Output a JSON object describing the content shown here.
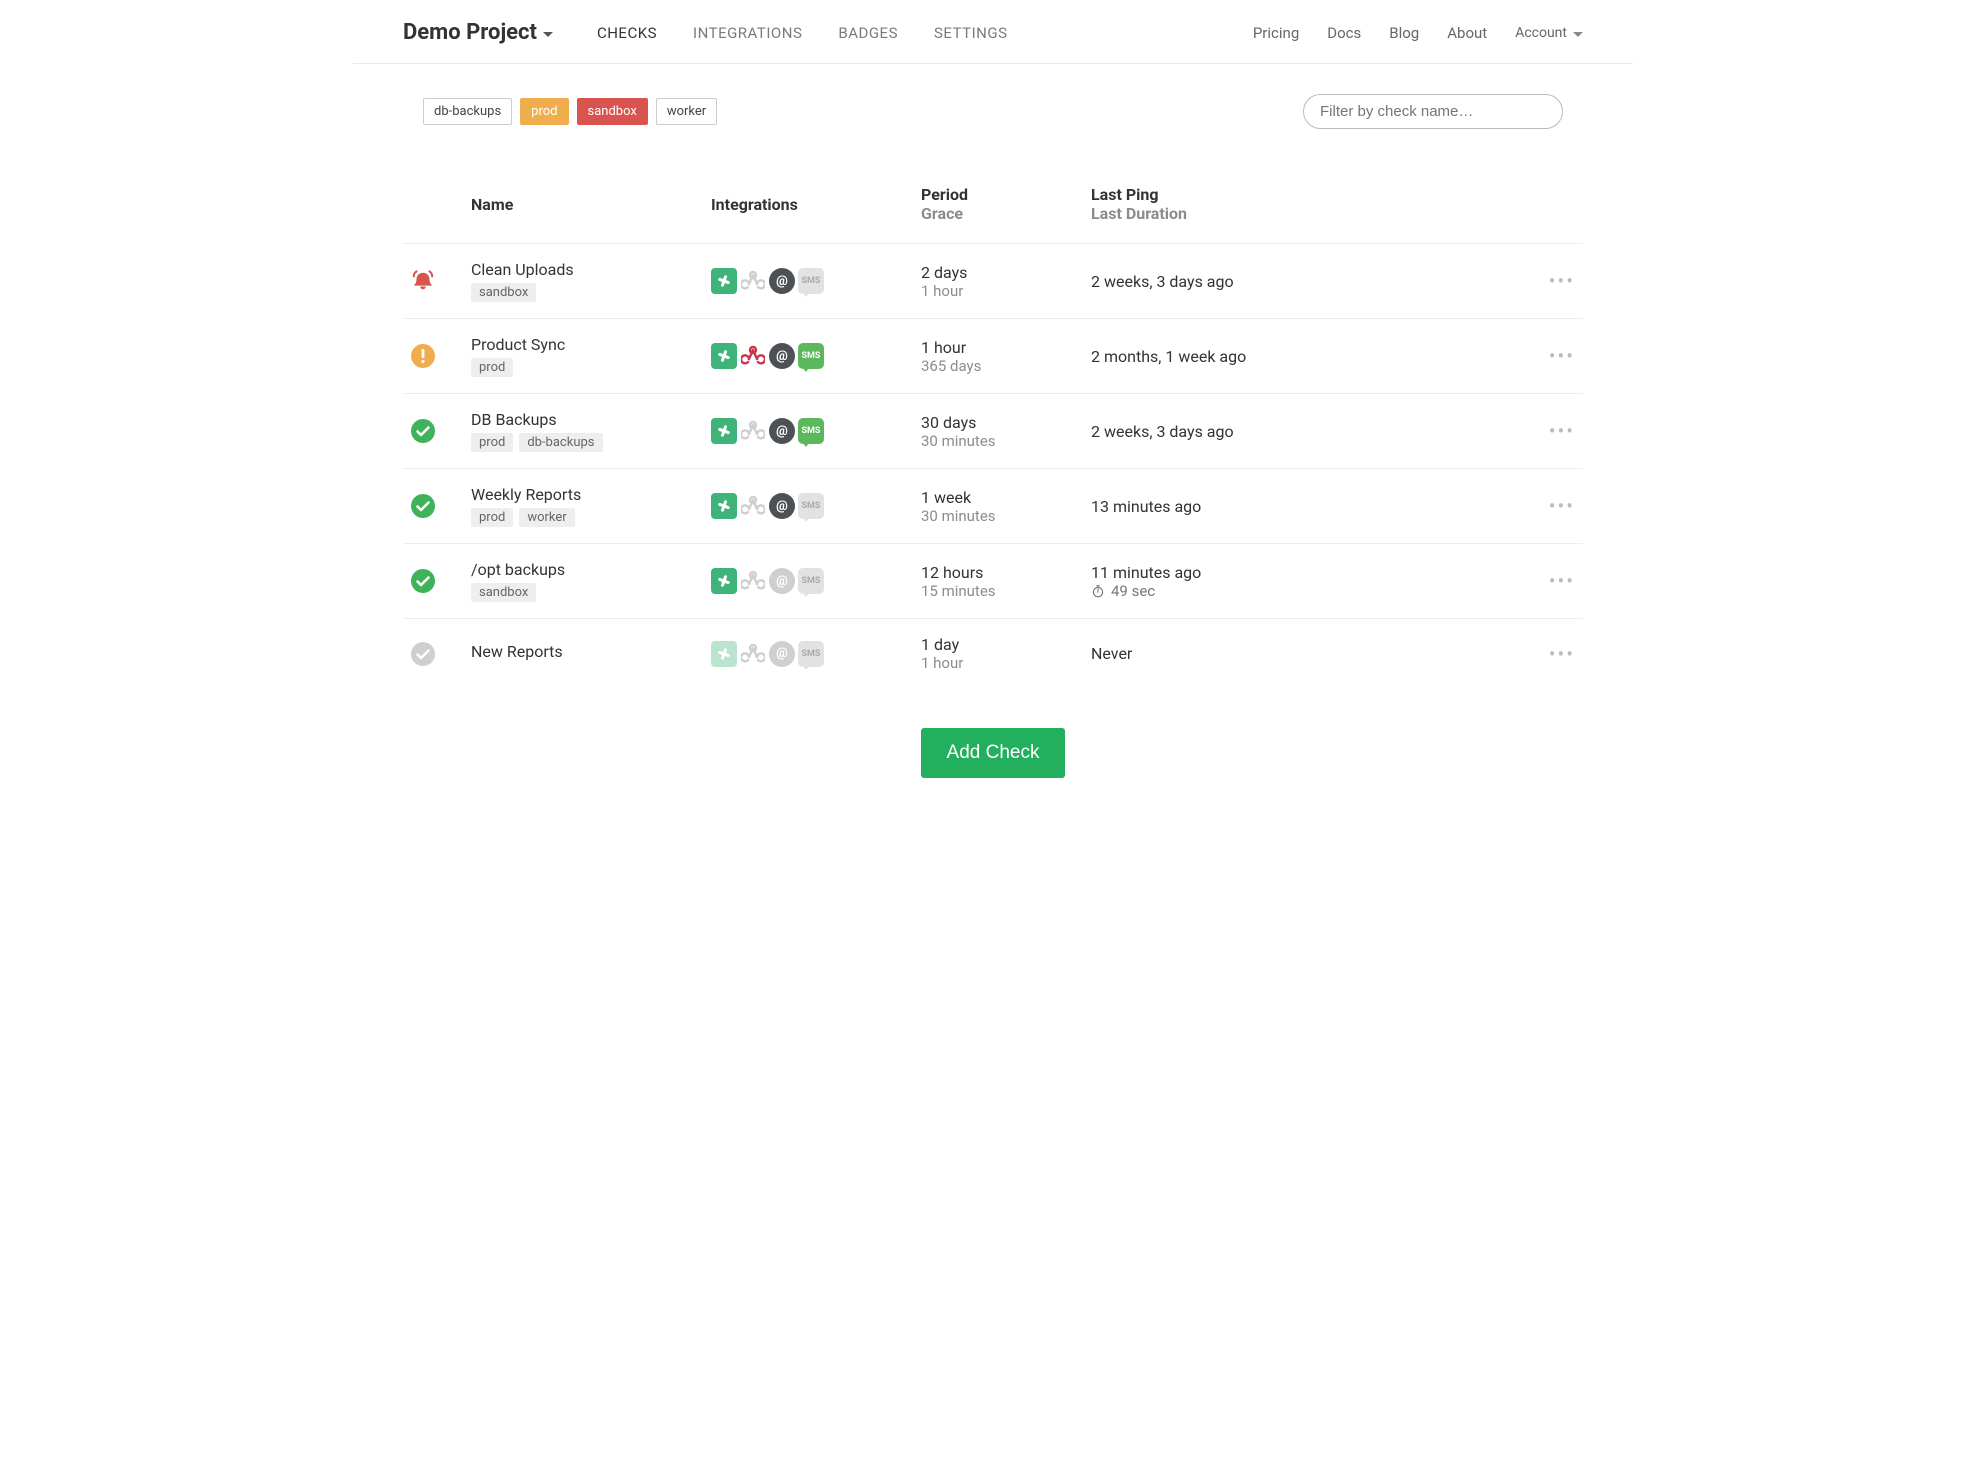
{
  "header": {
    "project_name": "Demo Project",
    "tabs": [
      {
        "label": "CHECKS",
        "active": true
      },
      {
        "label": "INTEGRATIONS",
        "active": false
      },
      {
        "label": "BADGES",
        "active": false
      },
      {
        "label": "SETTINGS",
        "active": false
      }
    ],
    "right_links": [
      "Pricing",
      "Docs",
      "Blog",
      "About"
    ],
    "account_label": "Account"
  },
  "filters": {
    "tags": [
      {
        "label": "db-backups",
        "style": "default"
      },
      {
        "label": "prod",
        "style": "orange"
      },
      {
        "label": "sandbox",
        "style": "red"
      },
      {
        "label": "worker",
        "style": "default"
      }
    ],
    "search_placeholder": "Filter by check name…"
  },
  "columns": {
    "name": "Name",
    "integrations": "Integrations",
    "period": "Period",
    "grace": "Grace",
    "last_ping": "Last Ping",
    "last_duration": "Last Duration"
  },
  "checks": [
    {
      "status": "down",
      "name": "Clean Uploads",
      "tags": [
        "sandbox"
      ],
      "integrations": {
        "slack": true,
        "webhook": false,
        "email": true,
        "sms": false
      },
      "period": "2 days",
      "grace": "1 hour",
      "last_ping": "2 weeks, 3 days ago",
      "duration": ""
    },
    {
      "status": "late",
      "name": "Product Sync",
      "tags": [
        "prod"
      ],
      "integrations": {
        "slack": true,
        "webhook": true,
        "email": true,
        "sms": true
      },
      "period": "1 hour",
      "grace": "365 days",
      "last_ping": "2 months, 1 week ago",
      "duration": ""
    },
    {
      "status": "up",
      "name": "DB Backups",
      "tags": [
        "prod",
        "db-backups"
      ],
      "integrations": {
        "slack": true,
        "webhook": false,
        "email": true,
        "sms": true
      },
      "period": "30 days",
      "grace": "30 minutes",
      "last_ping": "2 weeks, 3 days ago",
      "duration": ""
    },
    {
      "status": "up",
      "name": "Weekly Reports",
      "tags": [
        "prod",
        "worker"
      ],
      "integrations": {
        "slack": true,
        "webhook": false,
        "email": true,
        "sms": false
      },
      "period": "1 week",
      "grace": "30 minutes",
      "last_ping": "13 minutes ago",
      "duration": ""
    },
    {
      "status": "up",
      "name": "/opt backups",
      "tags": [
        "sandbox"
      ],
      "integrations": {
        "slack": true,
        "webhook": false,
        "email": false,
        "sms": false
      },
      "period": "12 hours",
      "grace": "15 minutes",
      "last_ping": "11 minutes ago",
      "duration": "49 sec"
    },
    {
      "status": "new",
      "name": "New Reports",
      "tags": [],
      "integrations": {
        "slack": false,
        "webhook": false,
        "email": false,
        "sms": false
      },
      "period": "1 day",
      "grace": "1 hour",
      "last_ping": "Never",
      "duration": ""
    }
  ],
  "add_check_label": "Add Check"
}
